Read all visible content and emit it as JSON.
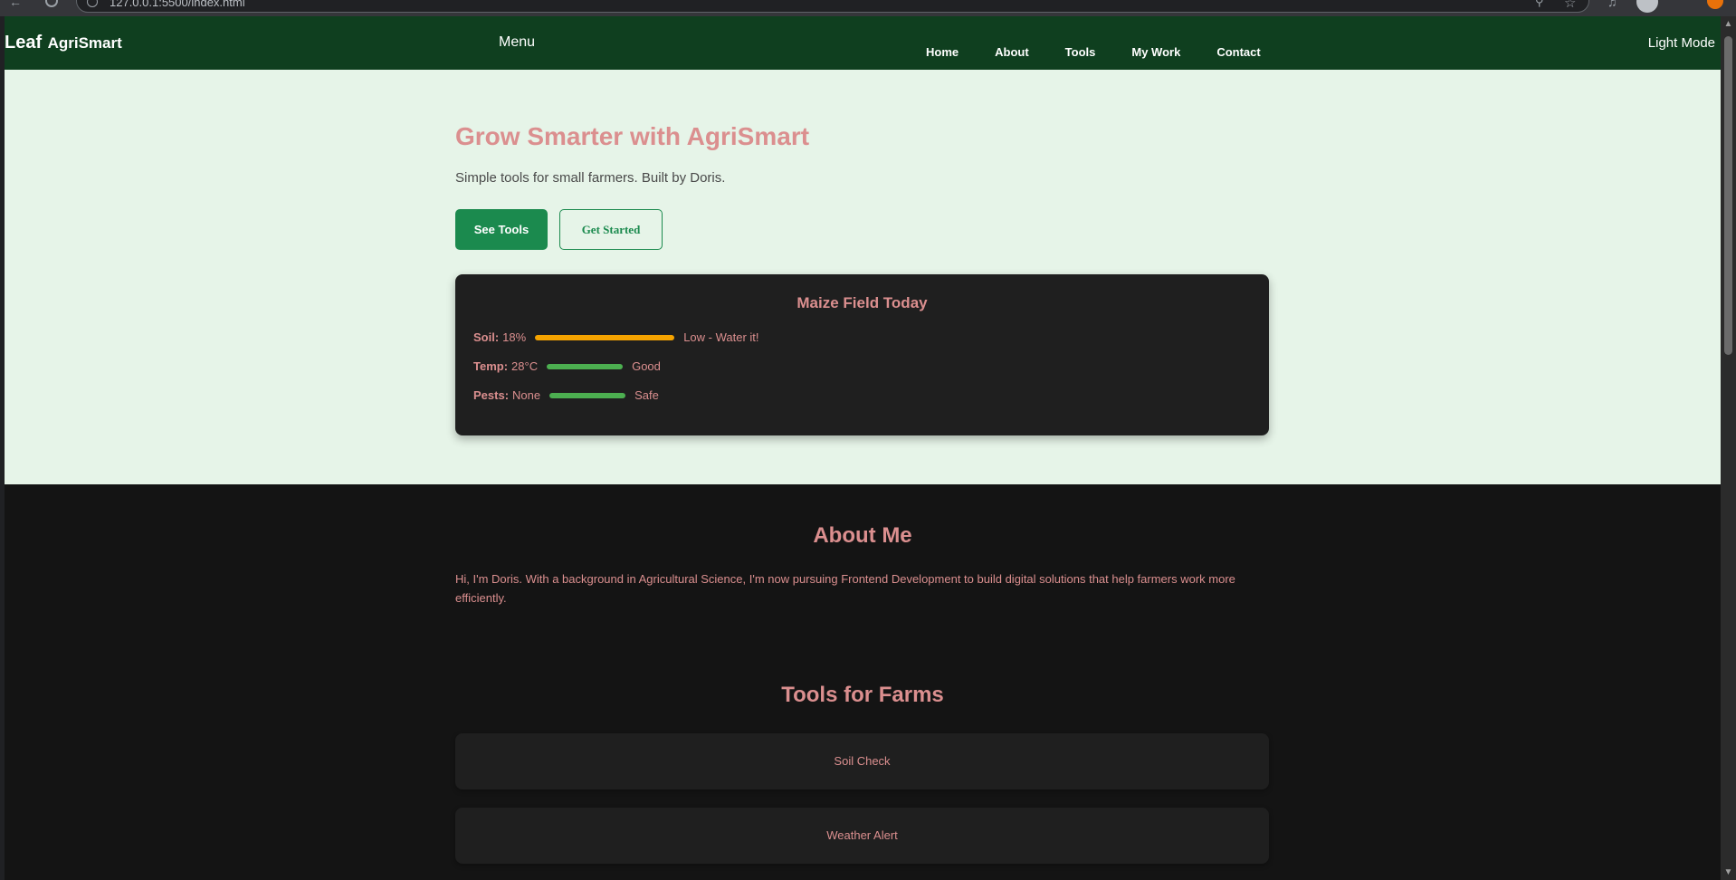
{
  "browser": {
    "url": "127.0.0.1:5500/index.html"
  },
  "header": {
    "logo_icon": "Leaf",
    "brand": "AgriSmart",
    "menu_label": "Menu",
    "nav": [
      "Home",
      "About",
      "Tools",
      "My Work",
      "Contact"
    ],
    "theme_toggle": "Light Mode",
    "bg_color": "#0f3f1f"
  },
  "hero": {
    "title": "Grow Smarter with AgriSmart",
    "subtitle": "Simple tools for small farmers. Built by Doris.",
    "primary_button": "See Tools",
    "secondary_button": "Get Started",
    "bg_color": "#e6f4e8",
    "accent_color": "#1b8a4e"
  },
  "field_card": {
    "title": "Maize Field Today",
    "stats": [
      {
        "label": "Soil:",
        "value": "18%",
        "status": "Low - Water it!",
        "bar_color": "#f5a300"
      },
      {
        "label": "Temp:",
        "value": "28°C",
        "status": "Good",
        "bar_color": "#4caf50"
      },
      {
        "label": "Pests:",
        "value": "None",
        "status": "Safe",
        "bar_color": "#4caf50"
      }
    ]
  },
  "about": {
    "title": "About Me",
    "text": "Hi, I'm Doris. With a background in Agricultural Science, I'm now pursuing Frontend Development to build digital solutions that help farmers work more efficiently."
  },
  "tools": {
    "title": "Tools for Farms",
    "items": [
      "Soil Check",
      "Weather Alert"
    ]
  },
  "colors": {
    "heading": "#db8f8f",
    "dark_bg": "#141414",
    "card_bg": "#1f1f1f"
  }
}
